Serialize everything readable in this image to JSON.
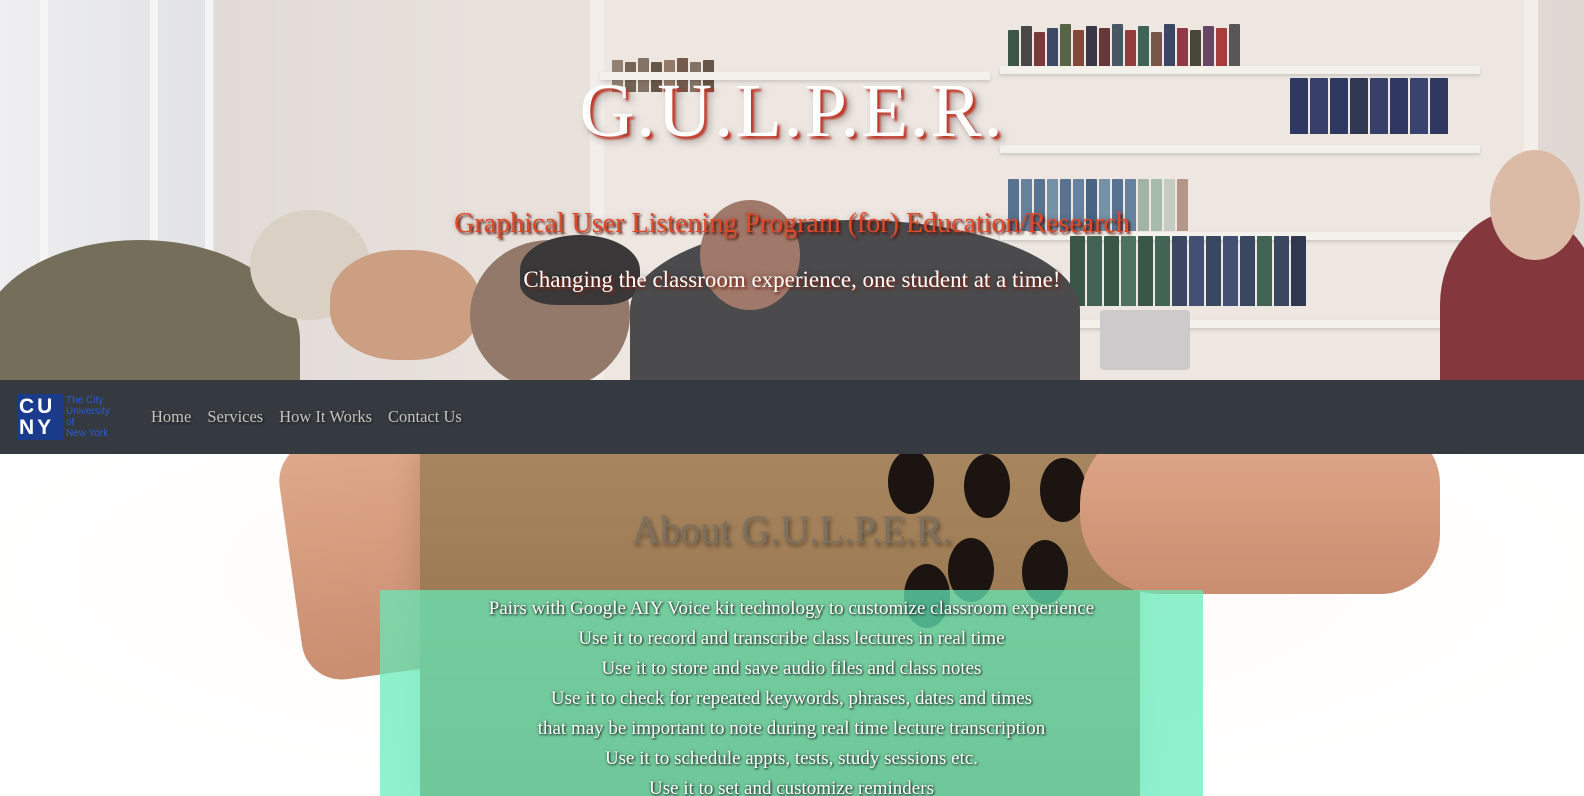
{
  "hero": {
    "title": "G.U.L.P.E.R.",
    "subtitle": "Graphical User Listening Program (for) Education/Research",
    "tagline": "Changing the classroom experience, one student at a time!"
  },
  "navbar": {
    "logo": {
      "mark_line1": "CU",
      "mark_line2": "NY",
      "text_lines": [
        "The City",
        "University",
        "of",
        "New York"
      ],
      "color": "#1a3a8c"
    },
    "links": [
      "Home",
      "Services",
      "How It Works",
      "Contact Us"
    ],
    "background": "#343a40"
  },
  "about": {
    "title": "About G.U.L.P.E.R.",
    "features": [
      "Pairs with Google AIY Voice kit technology to customize classroom experience",
      "Use it to record and transcribe class lectures in real time",
      "Use it to store and save audio files and class notes",
      "Use it to check for repeated keywords, phrases, dates and times",
      "that may be important to note during real time lecture transcription",
      "Use it to schedule appts, tests, study sessions etc.",
      "Use it to set and customize reminders"
    ],
    "box_color": "#64ecba"
  }
}
